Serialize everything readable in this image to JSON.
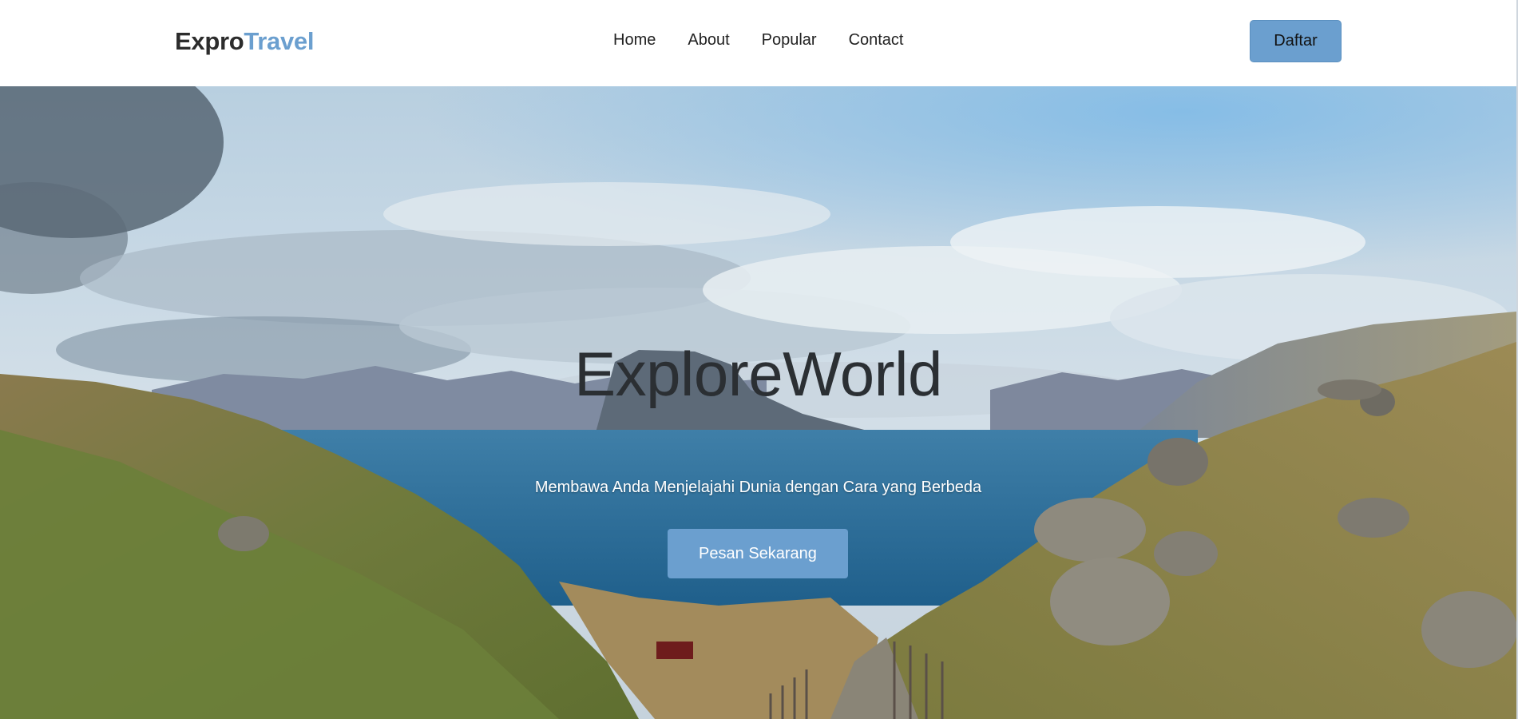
{
  "navbar": {
    "brand_part1": "Expro",
    "brand_part2": "Travel",
    "links": [
      "Home",
      "About",
      "Popular",
      "Contact"
    ],
    "cta_label": "Daftar"
  },
  "hero": {
    "title": "ExploreWorld",
    "subtitle": "Membawa Anda Menjelajahi Dunia dengan Cara yang Berbeda",
    "cta_label": "Pesan Sekarang",
    "background_scene": "coastal-landscape-image"
  },
  "colors": {
    "accent": "#6b9fcf",
    "brand_dark": "#2c2c2c",
    "nav_bg": "#ffffff",
    "hero_title": "#2b2f33"
  }
}
